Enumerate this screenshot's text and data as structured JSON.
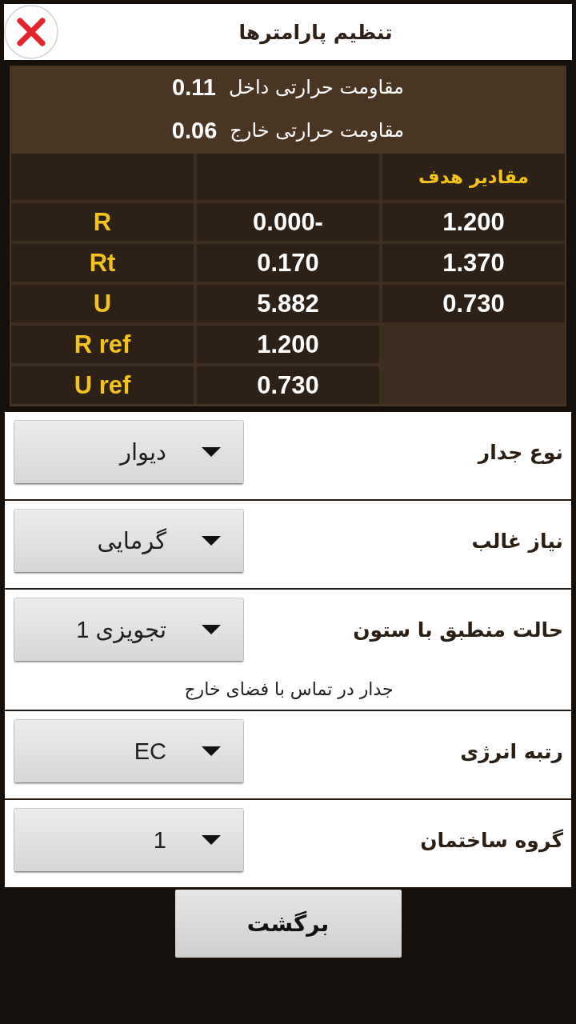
{
  "header": {
    "title": "تنظیم پارامترها"
  },
  "resistances": [
    {
      "label": "مقاومت حرارتی داخل",
      "value": "0.11"
    },
    {
      "label": "مقاومت حرارتی خارج",
      "value": "0.06"
    }
  ],
  "results_table": {
    "target_heading": "مقادیر هدف",
    "rows": [
      {
        "name": "R",
        "column_2": "0.000-",
        "target": "1.200"
      },
      {
        "name": "Rt",
        "column_2": "0.170",
        "target": "1.370"
      },
      {
        "name": "U",
        "column_2": "5.882",
        "target": "0.730"
      },
      {
        "name": "R ref",
        "column_2": "1.200"
      },
      {
        "name": "U ref",
        "column_2": "0.730"
      }
    ]
  },
  "fields": [
    {
      "label": "نوع جدار",
      "value": "دیوار"
    },
    {
      "label": "نیاز غالب",
      "value": "گرمایی"
    },
    {
      "label": "حالت منطبق با ستون",
      "value": "تجویزی 1",
      "note": "جدار در تماس با فضای خارج"
    },
    {
      "label": "رتبه انرژی",
      "value": "EC"
    },
    {
      "label": "گروه ساختمان",
      "value": "1"
    }
  ],
  "back_button": {
    "label": "برگشت"
  }
}
